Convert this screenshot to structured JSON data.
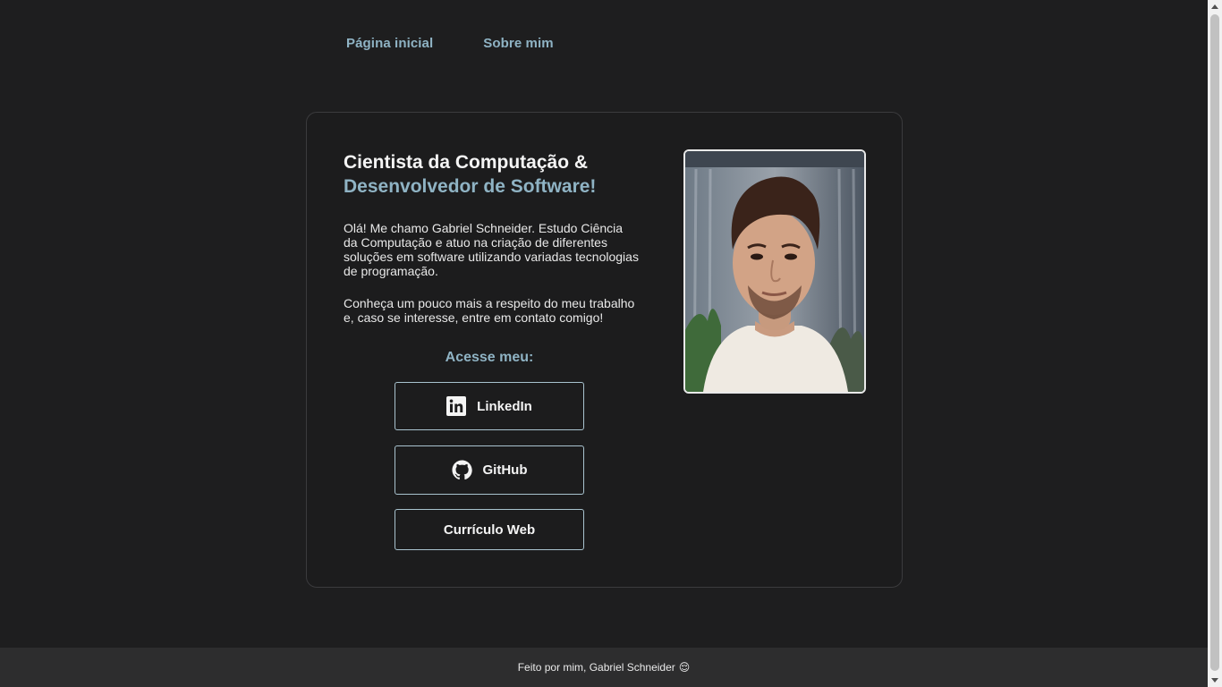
{
  "nav": {
    "home_label": "Página inicial",
    "about_label": "Sobre mim"
  },
  "hero": {
    "title_line1": "Cientista da Computação &",
    "title_line2": "Desenvolvedor de Software!",
    "paragraph1": "Olá! Me chamo Gabriel Schneider. Estudo Ciência da Computação e atuo na criação de diferentes soluções em software utilizando variadas tecnologias de programação.",
    "paragraph2": "Conheça um pouco mais a respeito do meu trabalho e, caso se interesse, entre em contato comigo!",
    "access_label": "Acesse meu:"
  },
  "buttons": {
    "linkedin": {
      "label": "LinkedIn",
      "icon": "linkedin-icon"
    },
    "github": {
      "label": "GitHub",
      "icon": "github-icon"
    },
    "cv": {
      "label": "Currículo Web"
    }
  },
  "photo": {
    "alt": "Foto de Gabriel Schneider"
  },
  "footer": {
    "text": "Feito por mim, Gabriel Schneider",
    "emoji": "😌"
  },
  "colors": {
    "background": "#1e1e1f",
    "accent": "#8fb3c4",
    "text": "#f2f2f2",
    "footer_bg": "#2d2d2e"
  }
}
